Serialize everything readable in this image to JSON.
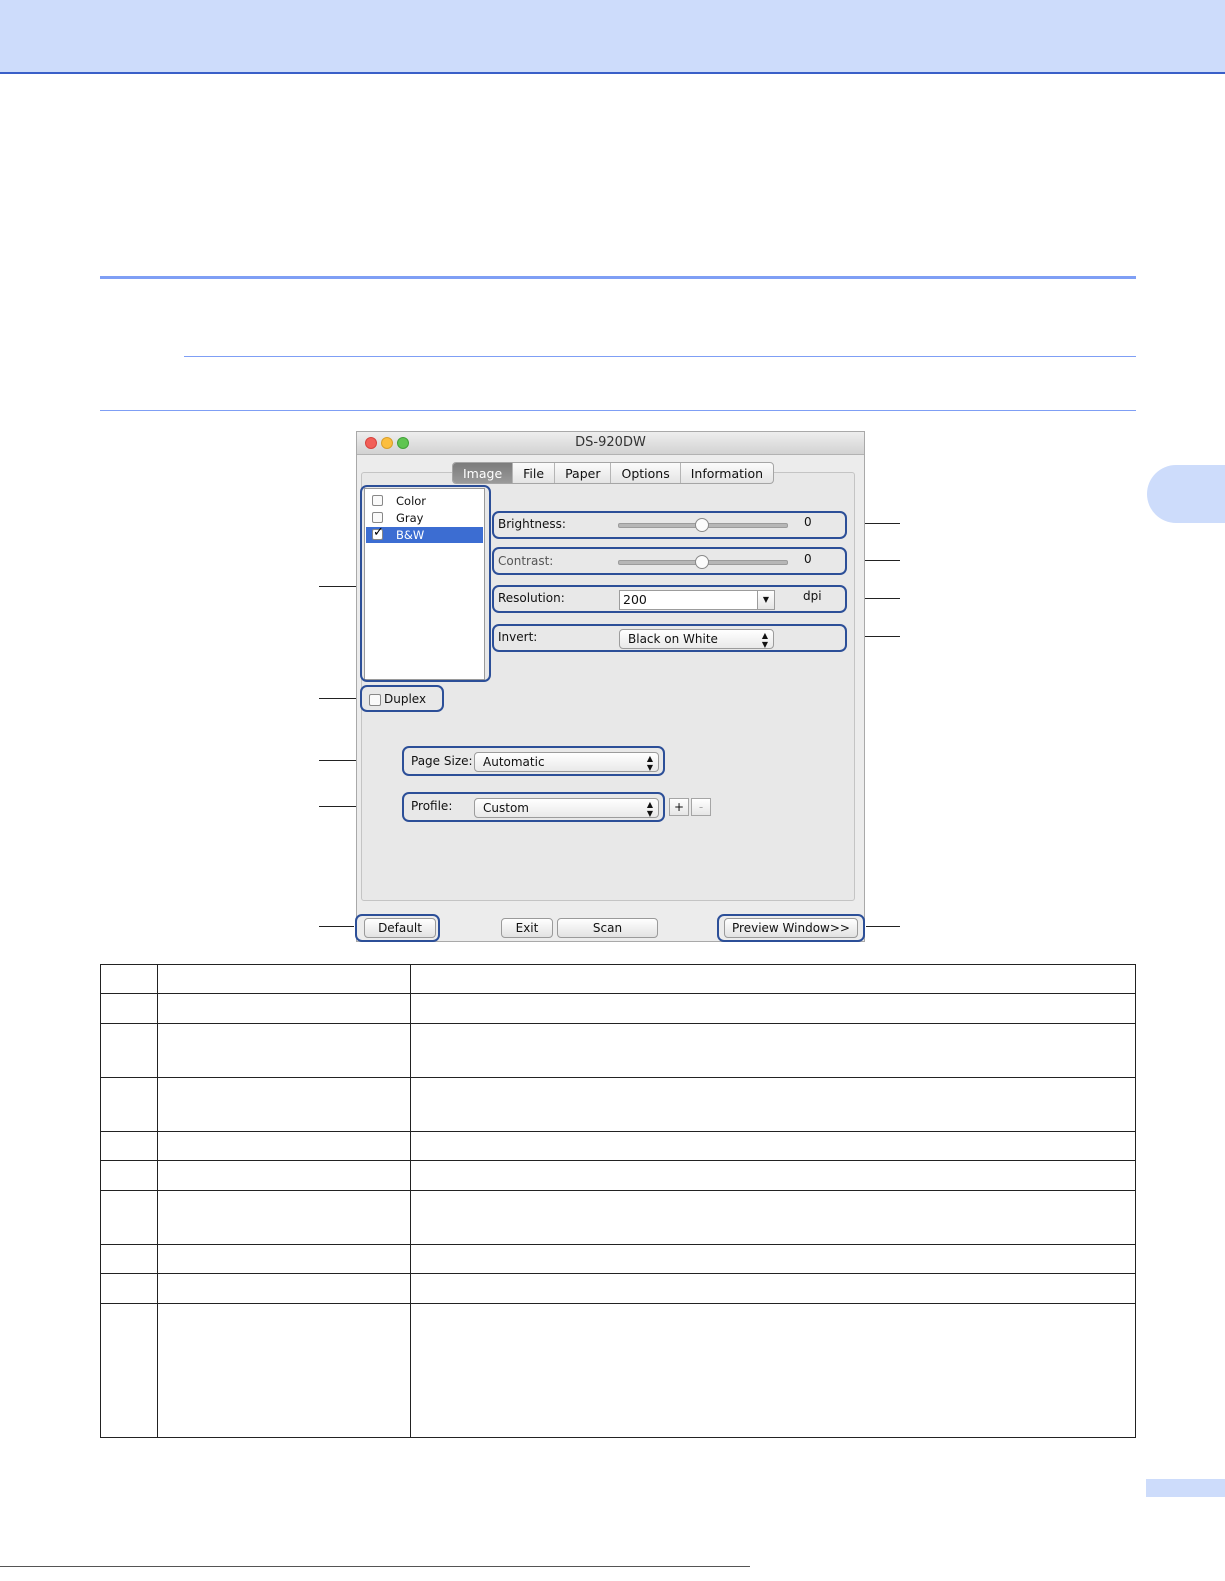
{
  "window": {
    "title": "DS-920DW",
    "tabs": [
      "Image",
      "File",
      "Paper",
      "Options",
      "Information"
    ],
    "active_tab": "Image"
  },
  "image_modes": [
    {
      "label": "Color",
      "checked": false,
      "selected": false
    },
    {
      "label": "Gray",
      "checked": false,
      "selected": false
    },
    {
      "label": "B&W",
      "checked": true,
      "selected": true
    }
  ],
  "brightness": {
    "label": "Brightness:",
    "value": "0",
    "level": 0.5
  },
  "contrast": {
    "label": "Contrast:",
    "value": "0",
    "level": 0.5
  },
  "resolution": {
    "label": "Resolution:",
    "value": "200",
    "unit": "dpi"
  },
  "invert": {
    "label": "Invert:",
    "value": "Black on White"
  },
  "duplex": {
    "label": "Duplex",
    "checked": false
  },
  "page_size": {
    "label": "Page Size:",
    "value": "Automatic"
  },
  "profile": {
    "label": "Profile:",
    "value": "Custom",
    "add": "+",
    "remove": "-"
  },
  "buttons": {
    "default": "Default",
    "exit": "Exit",
    "scan": "Scan",
    "preview": "Preview Window>>"
  },
  "colors": {
    "banner": "#cddcfb",
    "rule": "#7f9ff5",
    "highlight": "#2c4f98",
    "selection": "#3c6dd2"
  }
}
